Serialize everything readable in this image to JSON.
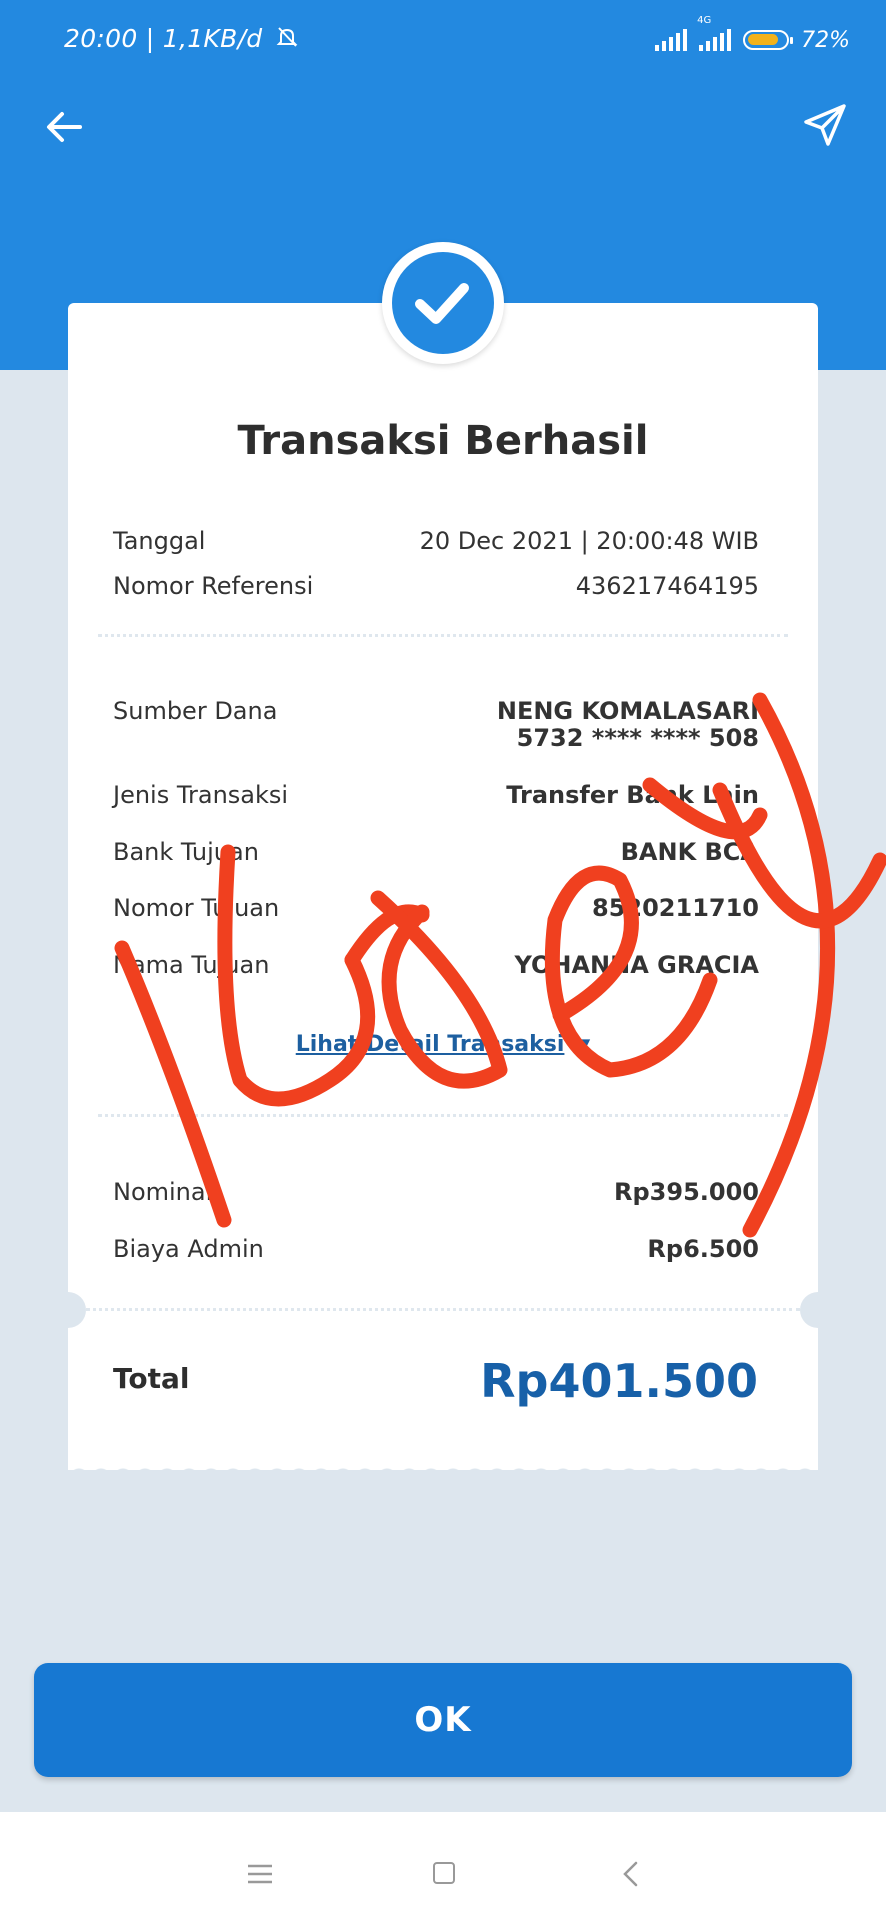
{
  "status_bar": {
    "time_speed": "20:00 | 1,1KB/d",
    "network_label": "4G",
    "battery": "72%"
  },
  "title": "Transaksi Berhasil",
  "info": {
    "date_label": "Tanggal",
    "date_value": "20 Dec 2021 | 20:00:48 WIB",
    "ref_label": "Nomor Referensi",
    "ref_value": "436217464195"
  },
  "details": {
    "source_label": "Sumber Dana",
    "source_name": "NENG KOMALASARI",
    "source_account": "5732 **** **** 508",
    "type_label": "Jenis Transaksi",
    "type_value": "Transfer Bank Lain",
    "bank_label": "Bank Tujuan",
    "bank_value": "BANK BCA",
    "dest_no_label": "Nomor Tujuan",
    "dest_no_value": "8520211710",
    "dest_name_label": "Nama Tujuan",
    "dest_name_value": "YOHANNA GRACIA",
    "link_label": "Lihat Detail Transaksi"
  },
  "amounts": {
    "nominal_label": "Nominal",
    "nominal_value": "Rp395.000",
    "admin_label": "Biaya Admin",
    "admin_value": "Rp6.500",
    "total_label": "Total",
    "total_value": "Rp401.500"
  },
  "ok_button": "OK",
  "colors": {
    "header_blue": "#2389e0",
    "button_blue": "#1778d2",
    "total_blue": "#1760a8",
    "scribble_red": "#f0401f"
  },
  "icons": [
    "back-arrow-icon",
    "share-send-icon",
    "check-icon",
    "muted-bell-icon",
    "menu-icon",
    "home-icon",
    "back-chevron-icon"
  ]
}
